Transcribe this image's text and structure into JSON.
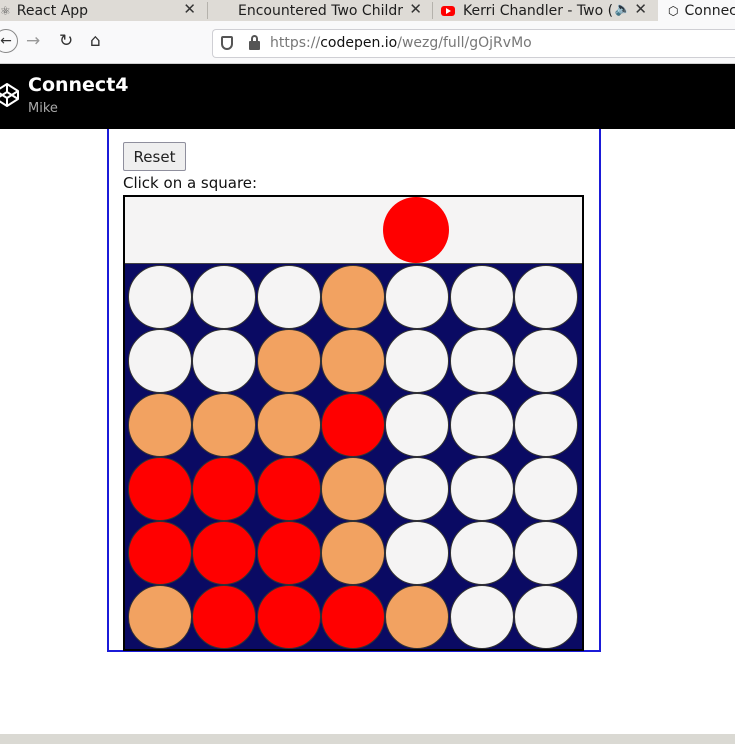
{
  "browser": {
    "tabs": [
      {
        "title": "React App",
        "icon": "react-icon",
        "active": false
      },
      {
        "title": "Encountered Two Childr",
        "icon": "person-icon",
        "active": false
      },
      {
        "title": "Kerri Chandler - Two (",
        "icon": "youtube-icon",
        "active": false
      },
      {
        "title": "Connec",
        "icon": "codepen-icon",
        "active": true
      }
    ],
    "url": {
      "scheme": "https://",
      "host": "codepen.io",
      "path": "/wezg/full/gOjRvMo"
    }
  },
  "codepen": {
    "pen_title": "Connect4",
    "author": "Mike"
  },
  "app": {
    "reset_label": "Reset",
    "instruction": "Click on a square:",
    "colors": {
      "board": "#0a0a63",
      "empty": "#f5f4f4",
      "red": "#ff0000",
      "orange": "#f2a261",
      "frame": "#1b1bd8"
    },
    "hover_column": 4,
    "hover_player": "red",
    "grid": [
      [
        "empty",
        "empty",
        "empty",
        "orange",
        "empty",
        "empty",
        "empty"
      ],
      [
        "empty",
        "empty",
        "orange",
        "orange",
        "empty",
        "empty",
        "empty"
      ],
      [
        "orange",
        "orange",
        "orange",
        "red",
        "empty",
        "empty",
        "empty"
      ],
      [
        "red",
        "red",
        "red",
        "orange",
        "empty",
        "empty",
        "empty"
      ],
      [
        "red",
        "red",
        "red",
        "orange",
        "empty",
        "empty",
        "empty"
      ],
      [
        "orange",
        "red",
        "red",
        "red",
        "orange",
        "empty",
        "empty"
      ]
    ]
  }
}
